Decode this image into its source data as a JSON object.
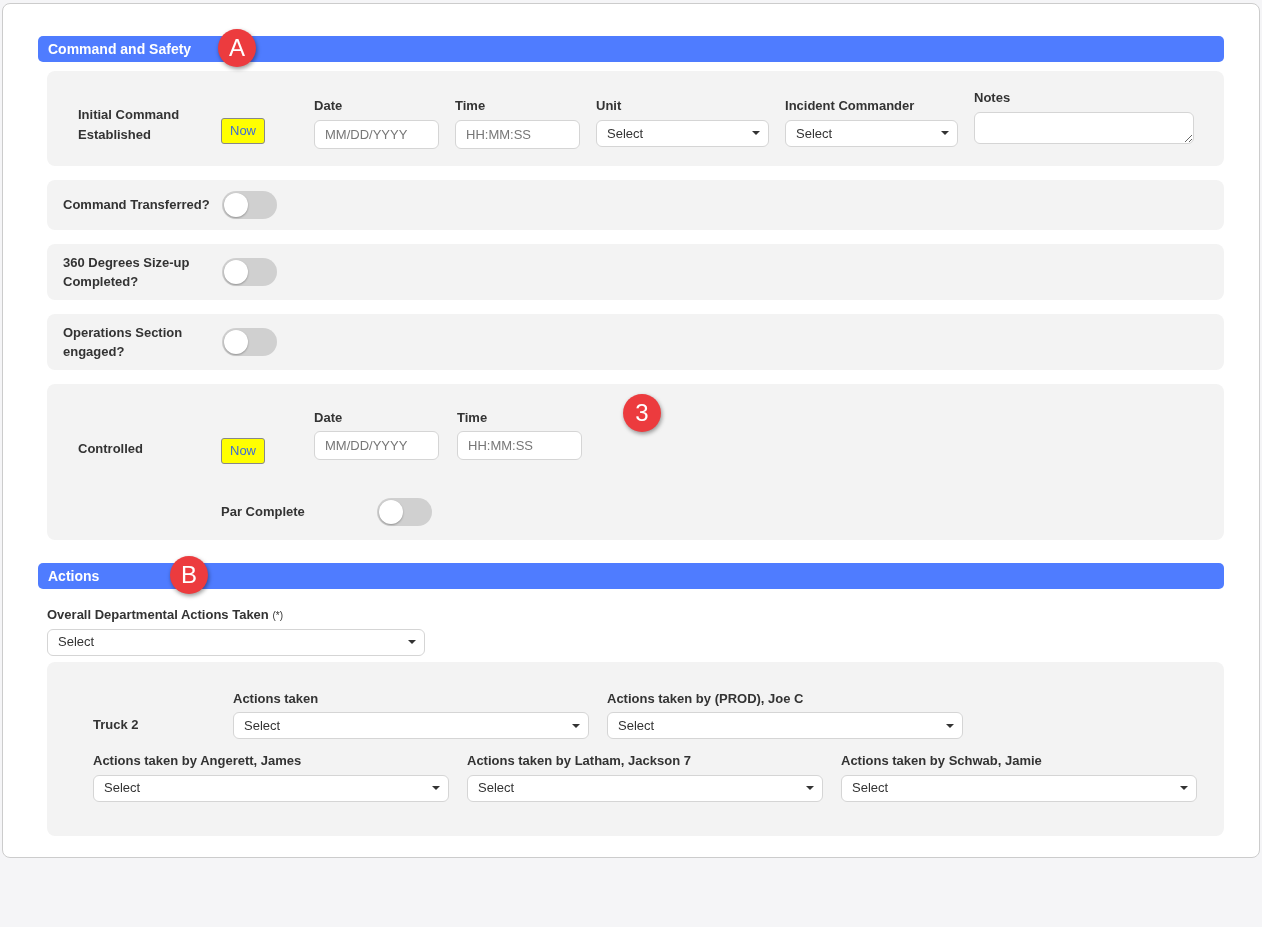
{
  "command_and_safety": {
    "title": "Command and Safety",
    "callout": "A",
    "initial_command": {
      "label": "Initial Command Established",
      "now_button": "Now",
      "fields": [
        {
          "kind": "input",
          "label": "Date",
          "placeholder": "MM/DD/YYYY"
        },
        {
          "kind": "input",
          "label": "Time",
          "placeholder": "HH:MM:SS"
        },
        {
          "kind": "select",
          "label": "Unit",
          "value": "Select"
        },
        {
          "kind": "select",
          "label": "Incident Commander",
          "value": "Select"
        },
        {
          "kind": "textarea",
          "label": "Notes"
        }
      ]
    },
    "toggles": [
      {
        "label": "Command Transferred?",
        "on": false
      },
      {
        "label": "360 Degrees Size-up Completed?",
        "on": false
      },
      {
        "label": "Operations Section engaged?",
        "on": false
      }
    ],
    "controlled": {
      "label": "Controlled",
      "now_button": "Now",
      "callout": "3",
      "fields": [
        {
          "kind": "input",
          "label": "Date",
          "placeholder": "MM/DD/YYYY"
        },
        {
          "kind": "input",
          "label": "Time",
          "placeholder": "HH:MM:SS"
        }
      ],
      "par": {
        "label": "Par Complete",
        "on": false
      }
    }
  },
  "actions": {
    "title": "Actions",
    "callout": "B",
    "overall": {
      "label": "Overall Departmental Actions Taken",
      "required": "(*)",
      "value": "Select"
    },
    "unit": {
      "label": "Truck 2",
      "fields": [
        {
          "label": "Actions taken",
          "value": "Select"
        },
        {
          "label": "Actions taken by (PROD), Joe C",
          "value": "Select"
        },
        {
          "label": "Actions taken by Angerett, James",
          "value": "Select"
        },
        {
          "label": "Actions taken by Latham, Jackson 7",
          "value": "Select"
        },
        {
          "label": "Actions taken by Schwab, Jamie",
          "value": "Select"
        }
      ]
    }
  }
}
